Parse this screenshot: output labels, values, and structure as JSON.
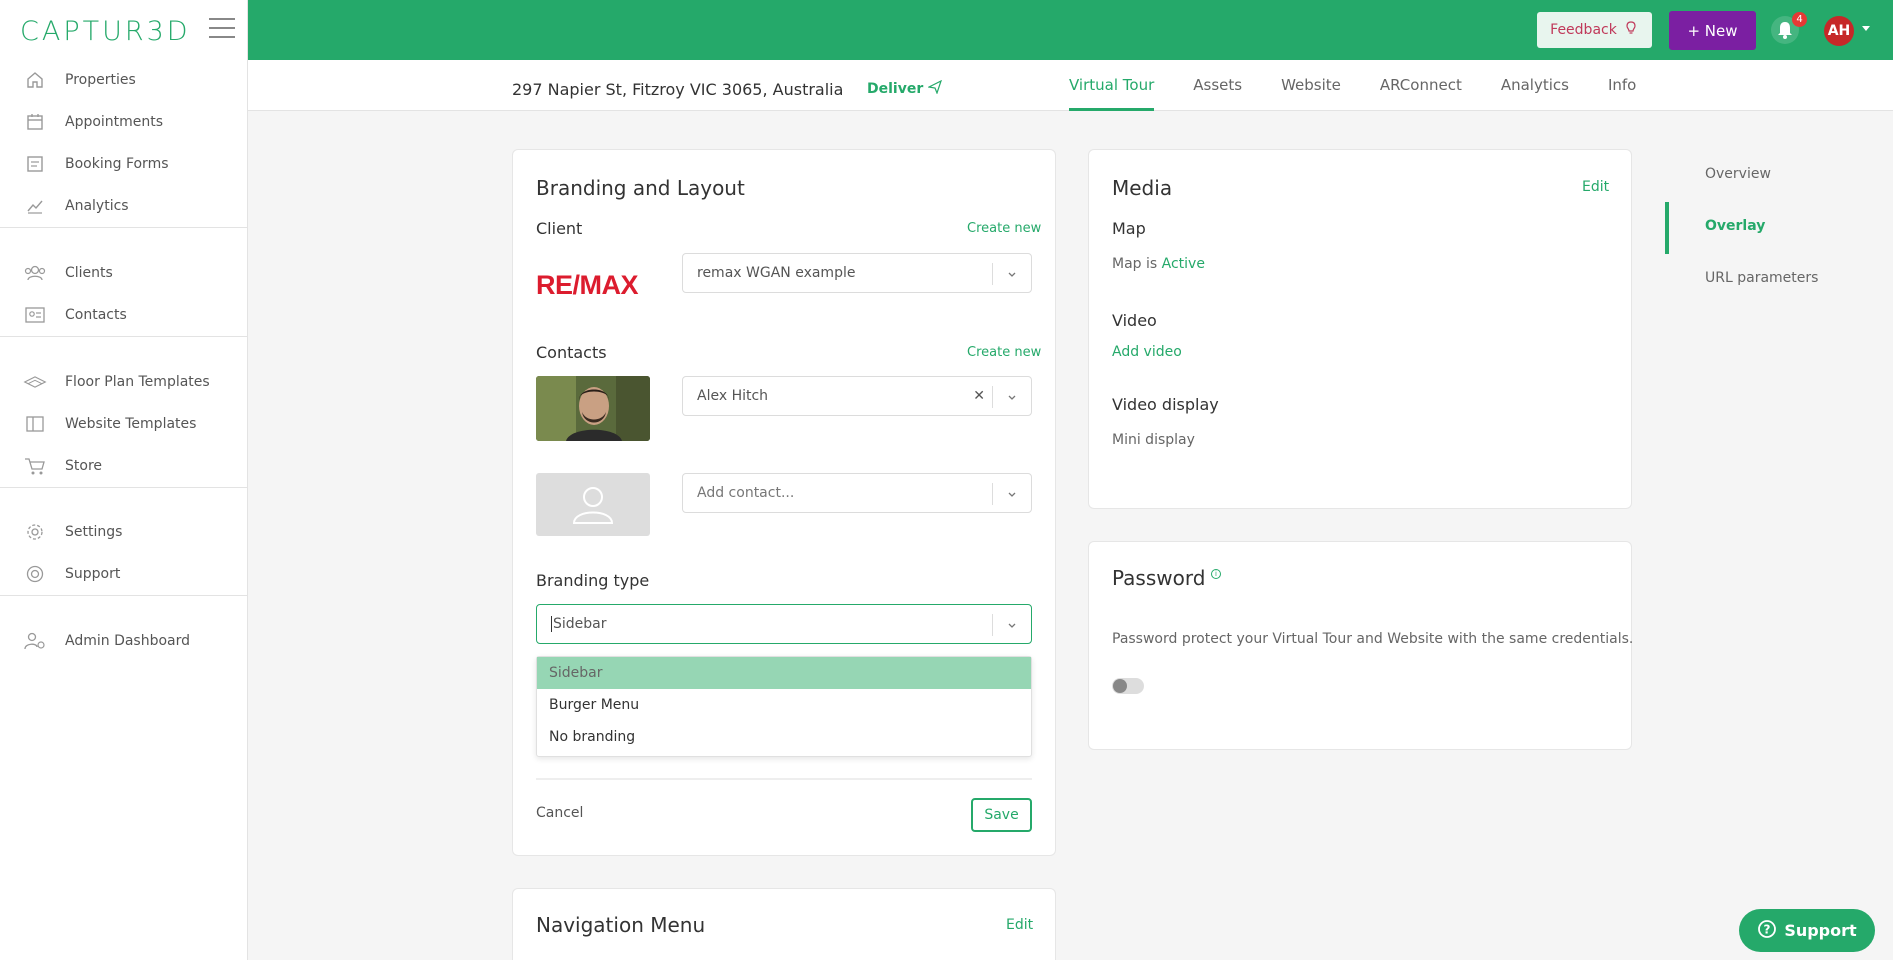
{
  "app": {
    "logo_text": "CAPTUR3D"
  },
  "sidebar": {
    "groups": [
      [
        {
          "label": "Properties",
          "icon": "home-icon"
        },
        {
          "label": "Appointments",
          "icon": "calendar-icon"
        },
        {
          "label": "Booking Forms",
          "icon": "form-icon"
        },
        {
          "label": "Analytics",
          "icon": "chart-icon"
        }
      ],
      [
        {
          "label": "Clients",
          "icon": "users-icon"
        },
        {
          "label": "Contacts",
          "icon": "contact-card-icon"
        }
      ],
      [
        {
          "label": "Floor Plan Templates",
          "icon": "floorplan-icon"
        },
        {
          "label": "Website Templates",
          "icon": "layout-icon"
        },
        {
          "label": "Store",
          "icon": "cart-icon"
        }
      ],
      [
        {
          "label": "Settings",
          "icon": "gear-icon"
        },
        {
          "label": "Support",
          "icon": "lifebuoy-icon"
        }
      ],
      [
        {
          "label": "Admin Dashboard",
          "icon": "admin-icon"
        }
      ]
    ]
  },
  "topbar": {
    "feedback_label": "Feedback",
    "new_label": "+ New",
    "notification_count": "4",
    "avatar_initials": "AH",
    "brand_color": "#25a96a"
  },
  "subheader": {
    "address": "297 Napier St, Fitzroy VIC 3065, Australia",
    "deliver_label": "Deliver",
    "tabs": [
      {
        "label": "Virtual Tour",
        "active": true
      },
      {
        "label": "Assets",
        "active": false
      },
      {
        "label": "Website",
        "active": false
      },
      {
        "label": "ARConnect",
        "active": false
      },
      {
        "label": "Analytics",
        "active": false
      },
      {
        "label": "Info",
        "active": false
      }
    ]
  },
  "branding": {
    "title": "Branding and Layout",
    "client_label": "Client",
    "create_new_label": "Create new",
    "client_logo_text": "RE/MAX",
    "client_value": "remax WGAN example",
    "contacts_label": "Contacts",
    "contact_value": "Alex Hitch",
    "add_contact_placeholder": "Add contact...",
    "branding_type_label": "Branding type",
    "branding_type_value": "Sidebar",
    "options": [
      "Sidebar",
      "Burger Menu",
      "No branding"
    ],
    "cancel_label": "Cancel",
    "save_label": "Save"
  },
  "navigation_menu": {
    "title": "Navigation Menu",
    "edit_label": "Edit"
  },
  "media": {
    "title": "Media",
    "edit_label": "Edit",
    "map_label": "Map",
    "map_status_prefix": "Map is",
    "map_status": "Active",
    "video_label": "Video",
    "add_video_label": "Add video",
    "video_display_label": "Video display",
    "video_display_value": "Mini display"
  },
  "password": {
    "title": "Password",
    "description": "Password protect your Virtual Tour and Website with the same credentials.",
    "enabled": false
  },
  "right_nav": [
    {
      "label": "Overview",
      "active": false
    },
    {
      "label": "Overlay",
      "active": true
    },
    {
      "label": "URL parameters",
      "active": false
    }
  ],
  "support_button_label": "Support"
}
